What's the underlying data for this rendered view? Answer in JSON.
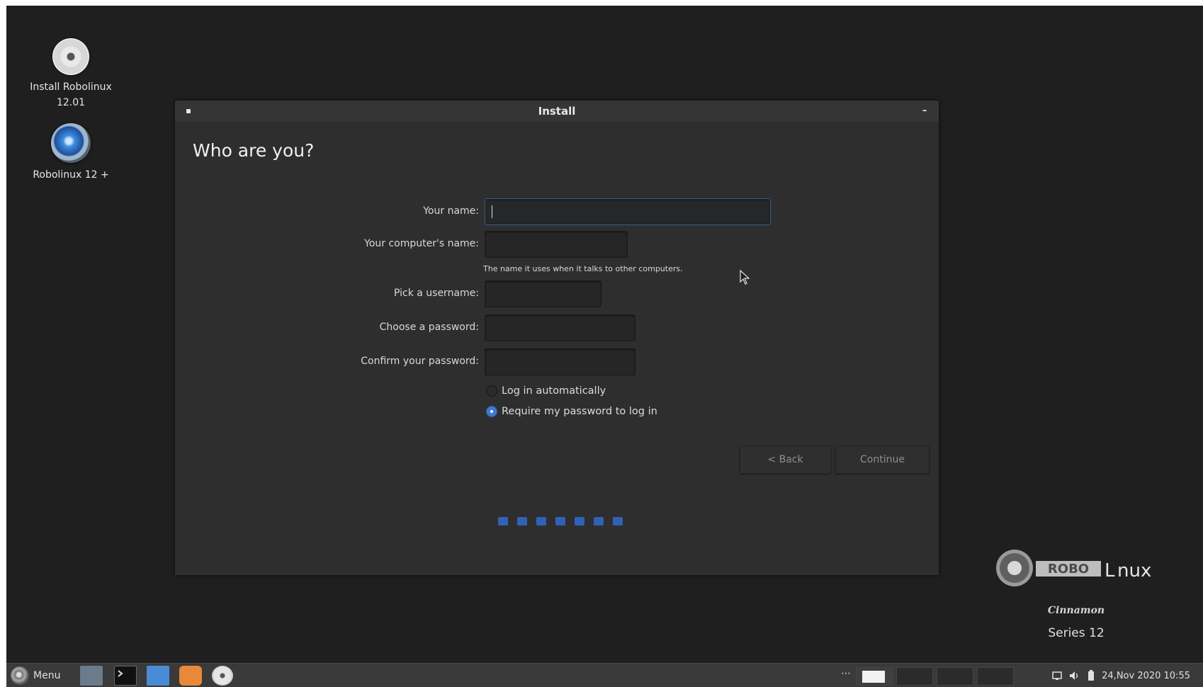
{
  "desktop": {
    "icons": [
      {
        "label_line1": "Install Robolinux",
        "label_line2": "12.01",
        "icon": "disc-icon"
      },
      {
        "label_line1": "Robolinux 12 +",
        "icon": "robolinux-logo-icon"
      }
    ]
  },
  "window": {
    "title": "Install",
    "heading": "Who are you?",
    "form": {
      "name_label": "Your name:",
      "name_value": "",
      "computer_label": "Your computer's name:",
      "computer_value": "",
      "computer_hint": "The name it uses when it talks to other computers.",
      "username_label": "Pick a username:",
      "username_value": "",
      "password_label": "Choose a password:",
      "password_value": "",
      "confirm_label": "Confirm your password:",
      "confirm_value": "",
      "login_auto_label": "Log in automatically",
      "login_auto_checked": false,
      "require_password_label": "Require my password to log in",
      "require_password_checked": true
    },
    "buttons": {
      "back": "< Back",
      "continue": "Continue"
    },
    "progress": {
      "total_steps": 7,
      "color": "#2f62b7"
    }
  },
  "branding": {
    "wordmark": "ROBOLINUX",
    "edition": "Cinnamon",
    "series": "Series 12"
  },
  "taskbar": {
    "menu_label": "Menu",
    "launchers": [
      "show-desktop-icon",
      "terminal-icon",
      "files-icon",
      "firefox-icon",
      "install-disc-icon"
    ],
    "workspaces": 4,
    "active_workspace": 1,
    "datetime": "24,Nov 2020 10:55"
  },
  "colors": {
    "desktop_bg": "#1f1f1f",
    "window_bg": "#2e2e2e",
    "accent": "#3a7ad2"
  }
}
